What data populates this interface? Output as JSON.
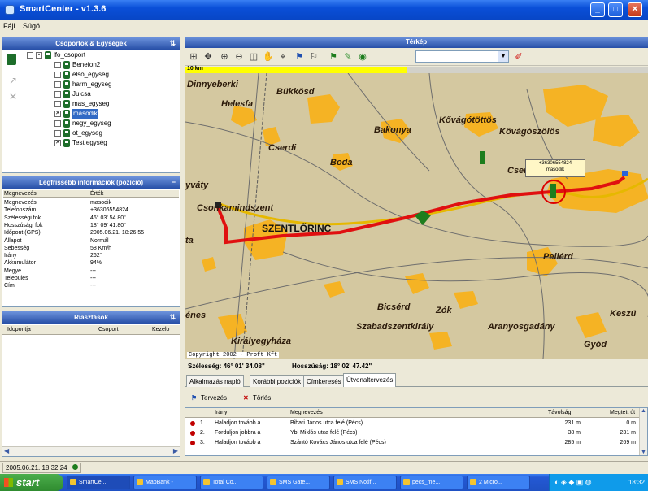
{
  "window": {
    "title": "SmartCenter - v1.3.6",
    "buttons": [
      "_",
      "□",
      "✕"
    ]
  },
  "menu": [
    "Fájl",
    "Súgó"
  ],
  "groups_panel": {
    "title": "Csoportok & Egységek",
    "root": "lfo_csoport",
    "items": [
      {
        "label": "Benefon2",
        "checked": false
      },
      {
        "label": "elso_egyseg",
        "checked": false
      },
      {
        "label": "harm_egyseg",
        "checked": false
      },
      {
        "label": "Julcsa",
        "checked": false
      },
      {
        "label": "mas_egyseg",
        "checked": false
      },
      {
        "label": "masodik",
        "checked": true,
        "selected": true
      },
      {
        "label": "negy_egyseg",
        "checked": false
      },
      {
        "label": "ot_egyseg",
        "checked": false
      },
      {
        "label": "Test egység",
        "checked": true
      }
    ]
  },
  "info_panel": {
    "title": "Legfrissebb információk (pozíció)",
    "header": {
      "name": "Megnevezés",
      "value": "Érték"
    },
    "rows": [
      {
        "k": "Megnevezés",
        "v": "masodik"
      },
      {
        "k": "Telefonszám",
        "v": "+36306554824"
      },
      {
        "k": "Szélességi fok",
        "v": "46° 03' 54.80\""
      },
      {
        "k": "Hosszúsági fok",
        "v": "18° 09' 41.80\""
      },
      {
        "k": "Időpont (GPS)",
        "v": "2005.06.21. 18:26:55"
      },
      {
        "k": "Állapot",
        "v": "Normál"
      },
      {
        "k": "Sebesség",
        "v": "58 Km/h"
      },
      {
        "k": "Irány",
        "v": "262°"
      },
      {
        "k": "Akkumulátor",
        "v": "94%"
      },
      {
        "k": "Megye",
        "v": "---"
      },
      {
        "k": "Település",
        "v": "---"
      },
      {
        "k": "Cím",
        "v": "---"
      }
    ]
  },
  "alarms_panel": {
    "title": "Riasztások",
    "columns": [
      "Idopontja",
      "Csoport",
      "Kezelo"
    ]
  },
  "map_panel": {
    "title": "Térkép",
    "scale_label": "10 km",
    "scale_fraction": 0.48,
    "copyright": "Copyright 2002 - Proft Kft",
    "callout": {
      "phone": "+36306554824",
      "name": "masodik"
    },
    "places": [
      "Dinnyeberki",
      "Bükkösd",
      "Helesfa",
      "Kővágótöttös",
      "Bakonya",
      "Kővágószőlős",
      "Cserdi",
      "Boda",
      "Cserkút",
      "yváty",
      "Csonkamindszent",
      "SZENTLŐRINC",
      "ta",
      "Pellérd",
      "énes",
      "Bicsérd",
      "Zók",
      "Szabadszentkirály",
      "Aranyosgadány",
      "Keszü",
      "Királyegyháza",
      "Gyód"
    ]
  },
  "coords": {
    "lat": "Szélesség: 46° 01' 34.08\"",
    "lon": "Hosszúság: 18° 02' 47.42\""
  },
  "tabs": [
    "Alkalmazás napló",
    "Korábbi pozíciók",
    "Címkeresés",
    "Útvonaltervezés"
  ],
  "route_toolbar": {
    "plan": "Tervezés",
    "delete": "Törlés"
  },
  "route_table": {
    "columns": [
      "Irány",
      "Megnevezés",
      "Távolság",
      "Megtett út"
    ],
    "rows": [
      {
        "n": "1.",
        "dir": "Haladjon tovább a",
        "name": "Bihari János utca felé (Pécs)",
        "dist": "231 m",
        "done": "0 m"
      },
      {
        "n": "2.",
        "dir": "Forduljon jobbra a",
        "name": "Ybl Miklós utca felé (Pécs)",
        "dist": "38 m",
        "done": "231 m"
      },
      {
        "n": "3.",
        "dir": "Haladjon tovább a",
        "name": "Szántó Kovács János utca felé (Pécs)",
        "dist": "285 m",
        "done": "269 m"
      }
    ]
  },
  "status": {
    "time": "2005.06.21. 18:32:24"
  },
  "taskbar": {
    "start": "start",
    "tasks": [
      "SmartCe...",
      "MapBank -",
      "Total Co...",
      "SMS Gate...",
      "SMS Notif...",
      "pecs_me...",
      "2 Micro..."
    ],
    "clock": "18:32"
  }
}
